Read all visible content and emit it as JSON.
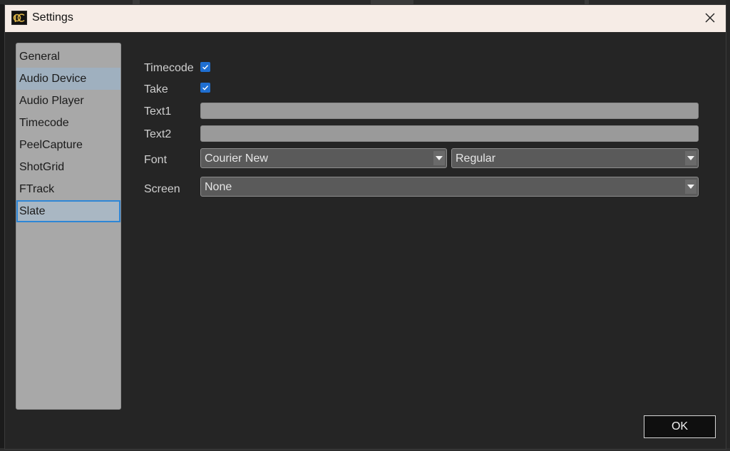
{
  "window": {
    "title": "Settings",
    "logo_text": "pC"
  },
  "sidebar": {
    "items": [
      {
        "label": "General"
      },
      {
        "label": "Audio Device"
      },
      {
        "label": "Audio Player"
      },
      {
        "label": "Timecode"
      },
      {
        "label": "PeelCapture"
      },
      {
        "label": "ShotGrid"
      },
      {
        "label": "FTrack"
      },
      {
        "label": "Slate"
      }
    ],
    "selected": "Slate",
    "hovered": "Audio Device"
  },
  "form": {
    "timecode_label": "Timecode",
    "timecode_checked": true,
    "take_label": "Take",
    "take_checked": true,
    "text1_label": "Text1",
    "text1_value": "",
    "text2_label": "Text2",
    "text2_value": "",
    "font_label": "Font",
    "font_family_value": "Courier New",
    "font_style_value": "Regular",
    "screen_label": "Screen",
    "screen_value": "None"
  },
  "footer": {
    "ok_label": "OK"
  },
  "colors": {
    "titlebar": "#f6ece6",
    "window_bg": "#252525",
    "checkbox_accent": "#1f6fd1",
    "selection_border": "#2e86d6"
  }
}
